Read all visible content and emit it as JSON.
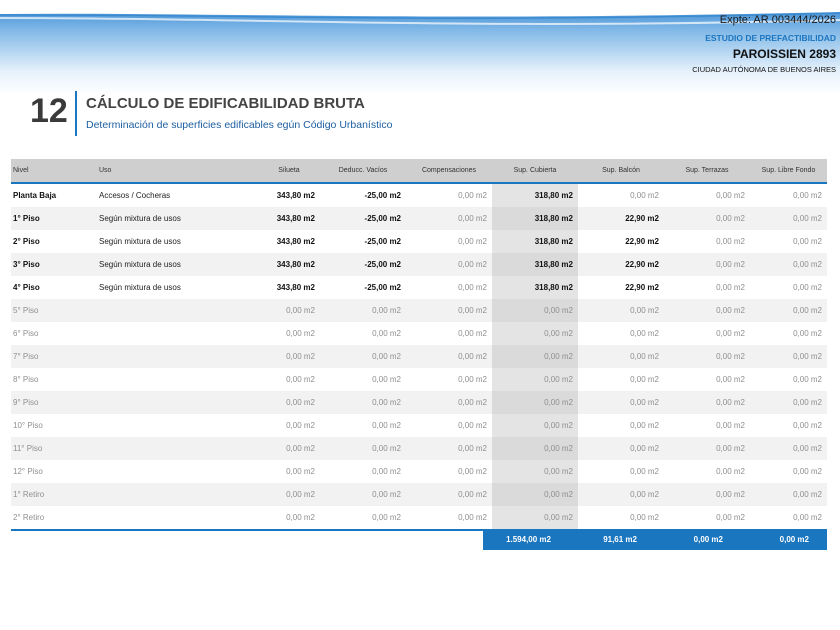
{
  "header": {
    "expediente": "Expte: AR 003444/2026",
    "study": "ESTUDIO DE PREFACTIBILIDAD",
    "street": "PAROISSIEN 2893",
    "city": "CIUDAD AUTÓNOMA DE BUENOS AIRES"
  },
  "section": {
    "number": "12",
    "title": "CÁLCULO DE EDIFICABILIDAD BRUTA",
    "subtitle": "Determinación de superficies edificables egún Código Urbanístico"
  },
  "colors": {
    "accent": "#1b76c0",
    "header_bg": "#cfcfcf"
  },
  "table": {
    "columns": [
      "Nivel",
      "Uso",
      "Silueta",
      "Deducc. Vacíos",
      "Compensaciones",
      "Sup. Cubierta",
      "Sup. Balcón",
      "Sup. Terrazas",
      "Sup. Libre Fondo"
    ],
    "rows": [
      {
        "nivel": "Planta Baja",
        "uso": "Accesos / Cocheras",
        "silueta": "343,80 m2",
        "deducc": "-25,00 m2",
        "comp": "0,00 m2",
        "cubierta": "318,80 m2",
        "balcon": "0,00 m2",
        "terrazas": "0,00 m2",
        "libre": "0,00 m2"
      },
      {
        "nivel": "1° Piso",
        "uso": "Según mixtura de usos",
        "silueta": "343,80 m2",
        "deducc": "-25,00 m2",
        "comp": "0,00 m2",
        "cubierta": "318,80 m2",
        "balcon": "22,90 m2",
        "terrazas": "0,00 m2",
        "libre": "0,00 m2"
      },
      {
        "nivel": "2° Piso",
        "uso": "Según mixtura de usos",
        "silueta": "343,80 m2",
        "deducc": "-25,00 m2",
        "comp": "0,00 m2",
        "cubierta": "318,80 m2",
        "balcon": "22,90 m2",
        "terrazas": "0,00 m2",
        "libre": "0,00 m2"
      },
      {
        "nivel": "3° Piso",
        "uso": "Según mixtura de usos",
        "silueta": "343,80 m2",
        "deducc": "-25,00 m2",
        "comp": "0,00 m2",
        "cubierta": "318,80 m2",
        "balcon": "22,90 m2",
        "terrazas": "0,00 m2",
        "libre": "0,00 m2"
      },
      {
        "nivel": "4° Piso",
        "uso": "Según mixtura de usos",
        "silueta": "343,80 m2",
        "deducc": "-25,00 m2",
        "comp": "0,00 m2",
        "cubierta": "318,80 m2",
        "balcon": "22,90 m2",
        "terrazas": "0,00 m2",
        "libre": "0,00 m2"
      },
      {
        "nivel": "5° Piso",
        "uso": "",
        "silueta": "0,00 m2",
        "deducc": "0,00 m2",
        "comp": "0,00 m2",
        "cubierta": "0,00 m2",
        "balcon": "0,00 m2",
        "terrazas": "0,00 m2",
        "libre": "0,00 m2"
      },
      {
        "nivel": "6° Piso",
        "uso": "",
        "silueta": "0,00 m2",
        "deducc": "0,00 m2",
        "comp": "0,00 m2",
        "cubierta": "0,00 m2",
        "balcon": "0,00 m2",
        "terrazas": "0,00 m2",
        "libre": "0,00 m2"
      },
      {
        "nivel": "7° Piso",
        "uso": "",
        "silueta": "0,00 m2",
        "deducc": "0,00 m2",
        "comp": "0,00 m2",
        "cubierta": "0,00 m2",
        "balcon": "0,00 m2",
        "terrazas": "0,00 m2",
        "libre": "0,00 m2"
      },
      {
        "nivel": "8° Piso",
        "uso": "",
        "silueta": "0,00 m2",
        "deducc": "0,00 m2",
        "comp": "0,00 m2",
        "cubierta": "0,00 m2",
        "balcon": "0,00 m2",
        "terrazas": "0,00 m2",
        "libre": "0,00 m2"
      },
      {
        "nivel": "9° Piso",
        "uso": "",
        "silueta": "0,00 m2",
        "deducc": "0,00 m2",
        "comp": "0,00 m2",
        "cubierta": "0,00 m2",
        "balcon": "0,00 m2",
        "terrazas": "0,00 m2",
        "libre": "0,00 m2"
      },
      {
        "nivel": "10° Piso",
        "uso": "",
        "silueta": "0,00 m2",
        "deducc": "0,00 m2",
        "comp": "0,00 m2",
        "cubierta": "0,00 m2",
        "balcon": "0,00 m2",
        "terrazas": "0,00 m2",
        "libre": "0,00 m2"
      },
      {
        "nivel": "11° Piso",
        "uso": "",
        "silueta": "0,00 m2",
        "deducc": "0,00 m2",
        "comp": "0,00 m2",
        "cubierta": "0,00 m2",
        "balcon": "0,00 m2",
        "terrazas": "0,00 m2",
        "libre": "0,00 m2"
      },
      {
        "nivel": "12° Piso",
        "uso": "",
        "silueta": "0,00 m2",
        "deducc": "0,00 m2",
        "comp": "0,00 m2",
        "cubierta": "0,00 m2",
        "balcon": "0,00 m2",
        "terrazas": "0,00 m2",
        "libre": "0,00 m2"
      },
      {
        "nivel": "1° Retiro",
        "uso": "",
        "silueta": "0,00 m2",
        "deducc": "0,00 m2",
        "comp": "0,00 m2",
        "cubierta": "0,00 m2",
        "balcon": "0,00 m2",
        "terrazas": "0,00 m2",
        "libre": "0,00 m2"
      },
      {
        "nivel": "2° Retiro",
        "uso": "",
        "silueta": "0,00 m2",
        "deducc": "0,00 m2",
        "comp": "0,00 m2",
        "cubierta": "0,00 m2",
        "balcon": "0,00 m2",
        "terrazas": "0,00 m2",
        "libre": "0,00 m2"
      }
    ],
    "totals": {
      "cubierta": "1.594,00 m2",
      "balcon": "91,61 m2",
      "terrazas": "0,00 m2",
      "libre": "0,00 m2"
    }
  }
}
